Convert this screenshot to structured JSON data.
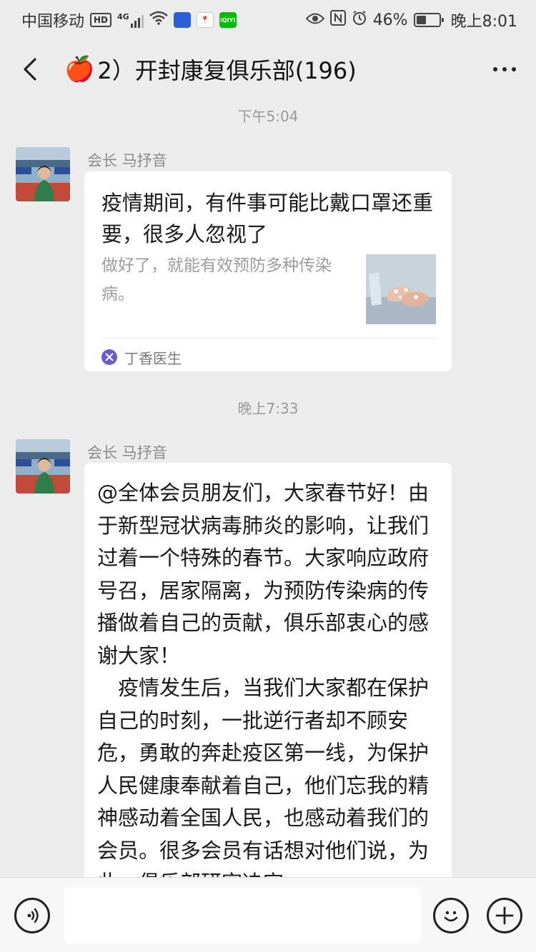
{
  "status_bar": {
    "carrier": "中国移动",
    "hd_badge": "HD",
    "network": "4G",
    "app_badge_3": "iQIYI",
    "battery_percent": "46%",
    "battery_level": 0.46,
    "time": "晚上8:01"
  },
  "header": {
    "title": "2）开封康复俱乐部(196)"
  },
  "messages": [
    {
      "time_label": "下午5:04",
      "sender": "会长 马抒音",
      "card": {
        "title": "疫情期间，有件事可能比戴口罩还重要，很多人忽视了",
        "description": "做好了，就能有效预防多种传染病。",
        "source": "丁香医生"
      }
    },
    {
      "time_label": "晚上7:33",
      "sender": "会长 马抒音",
      "paragraphs": [
        "@全体会员朋友们，大家春节好！由于新型冠状病毒肺炎的影响，让我们过着一个特殊的春节。大家响应政府号召，居家隔离，为预防传染病的传播做着自己的贡献，俱乐部衷心的感谢大家！",
        "疫情发生后，当我们大家都在保护自己的时刻，一批逆行者却不顾安危，勇敢的奔赴疫区第一线，为保护人民健康奉献着自己，他们忘我的精神感动着全国人民，也感动着我们的会员。很多会员有话想对他们说，为此，俱乐部研究决定"
      ]
    }
  ],
  "colors": {
    "background": "#ececec",
    "bubble": "#ffffff",
    "meta_text": "#9a9a9a"
  }
}
